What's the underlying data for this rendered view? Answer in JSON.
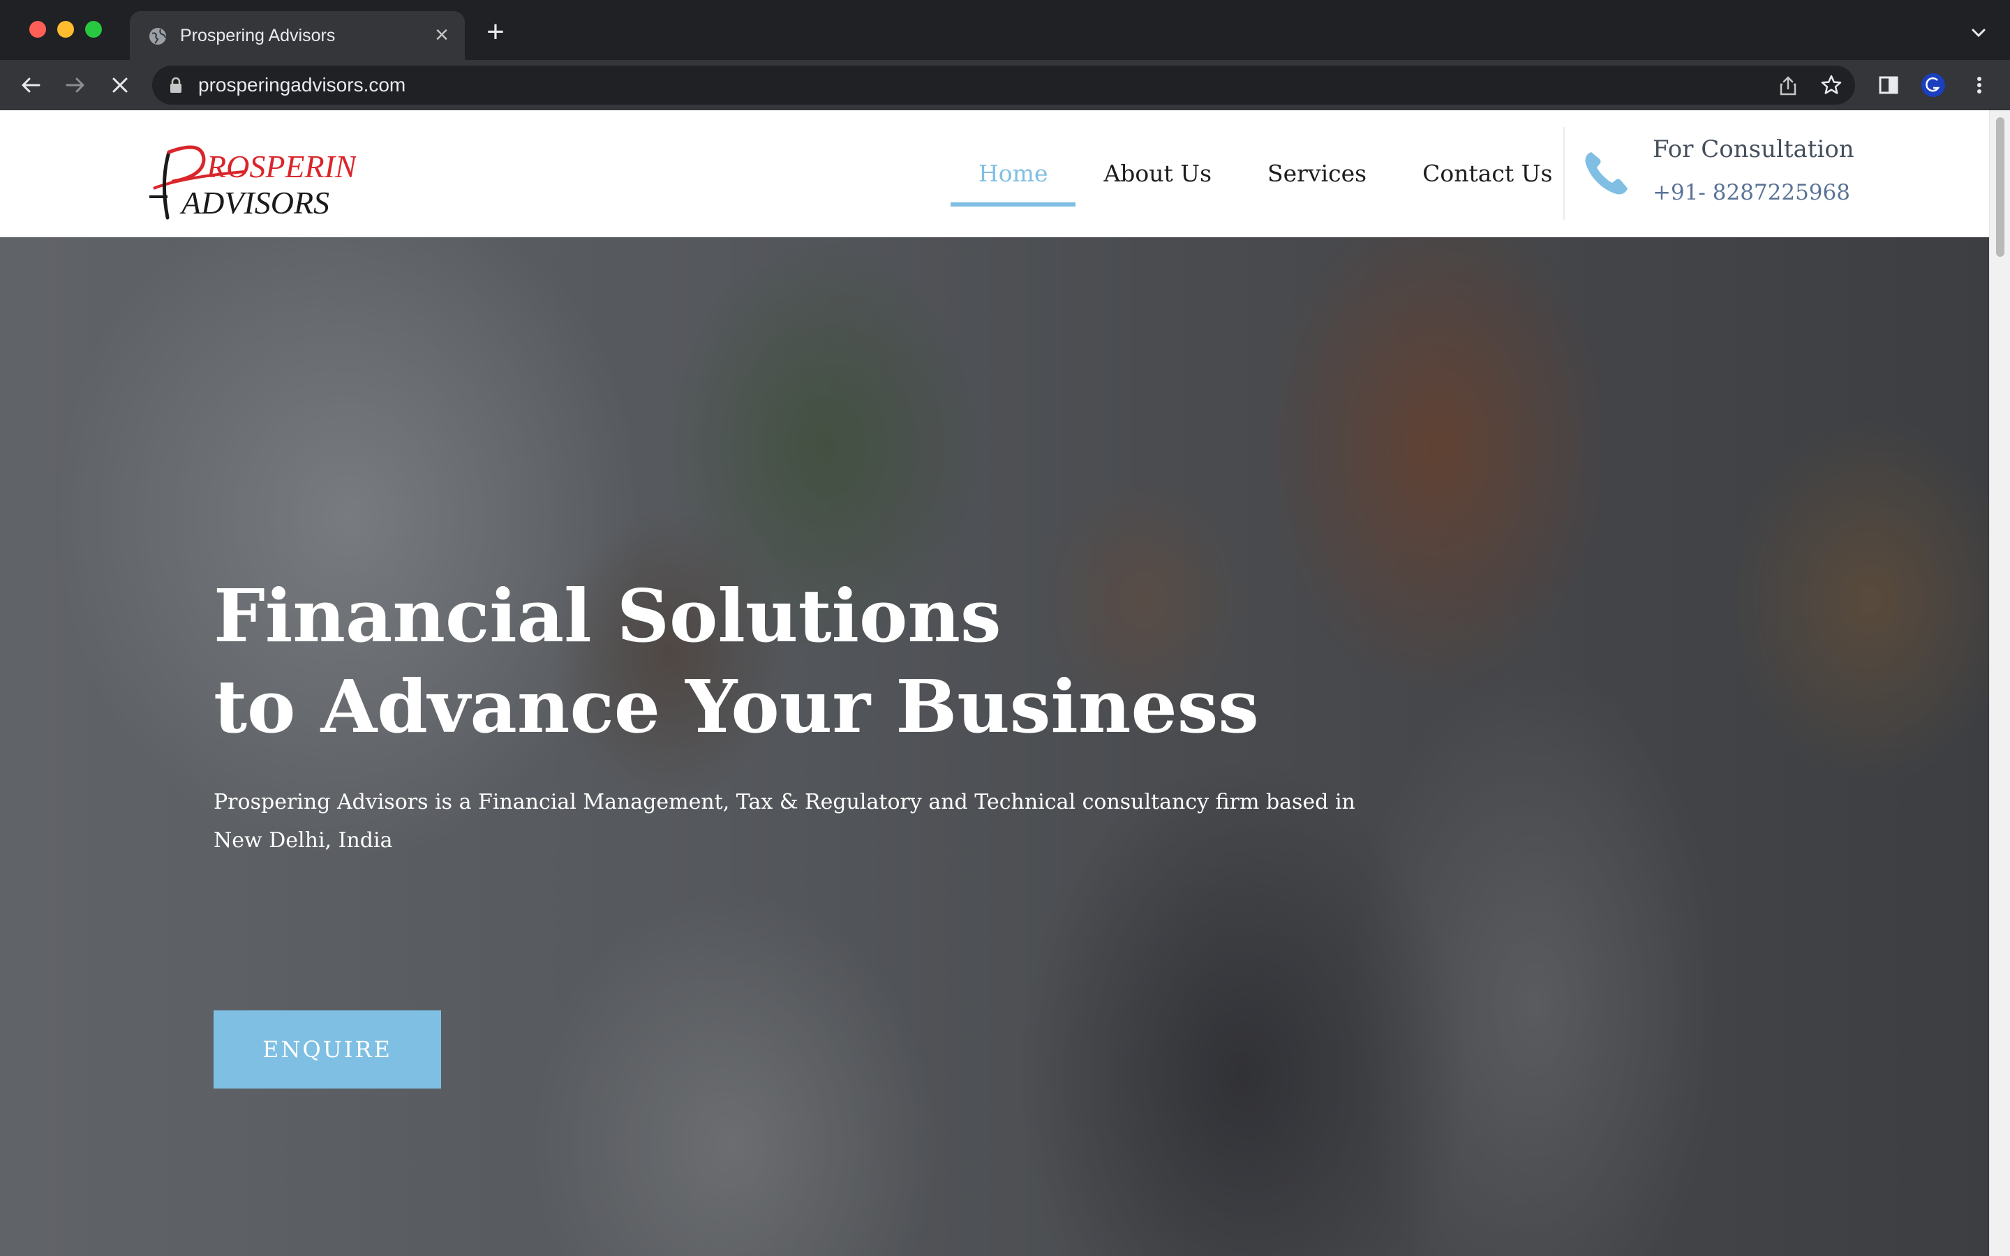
{
  "browser": {
    "tab_title": "Prospering Advisors",
    "url": "prosperingadvisors.com",
    "new_tab_symbol": "+",
    "close_symbol": "×"
  },
  "site": {
    "logo": {
      "line1": "ROSPERING",
      "line2": "ADVISORS",
      "initial": "P",
      "red": "#d9262b",
      "dark": "#1a1a1a"
    },
    "nav": [
      {
        "label": "Home",
        "active": true
      },
      {
        "label": "About Us",
        "active": false
      },
      {
        "label": "Services",
        "active": false
      },
      {
        "label": "Contact Us",
        "active": false
      }
    ],
    "consultation": {
      "title": "For Consultation",
      "phone": "+91- 8287225968"
    },
    "accent": "#7fbfe3"
  },
  "hero": {
    "title_line1": "Financial Solutions",
    "title_line2": "to Advance Your Business",
    "description": "Prospering Advisors is a Financial Management, Tax & Regulatory and Technical consultancy firm based in New Delhi, India",
    "cta_label": "ENQUIRE"
  },
  "icons": [
    "globe-icon",
    "close-icon",
    "plus-icon",
    "chevron-down-icon",
    "back-arrow-icon",
    "forward-arrow-icon",
    "stop-loading-icon",
    "lock-icon",
    "share-icon",
    "star-icon",
    "side-panel-icon",
    "profile-avatar-icon",
    "more-vert-icon",
    "phone-icon"
  ]
}
